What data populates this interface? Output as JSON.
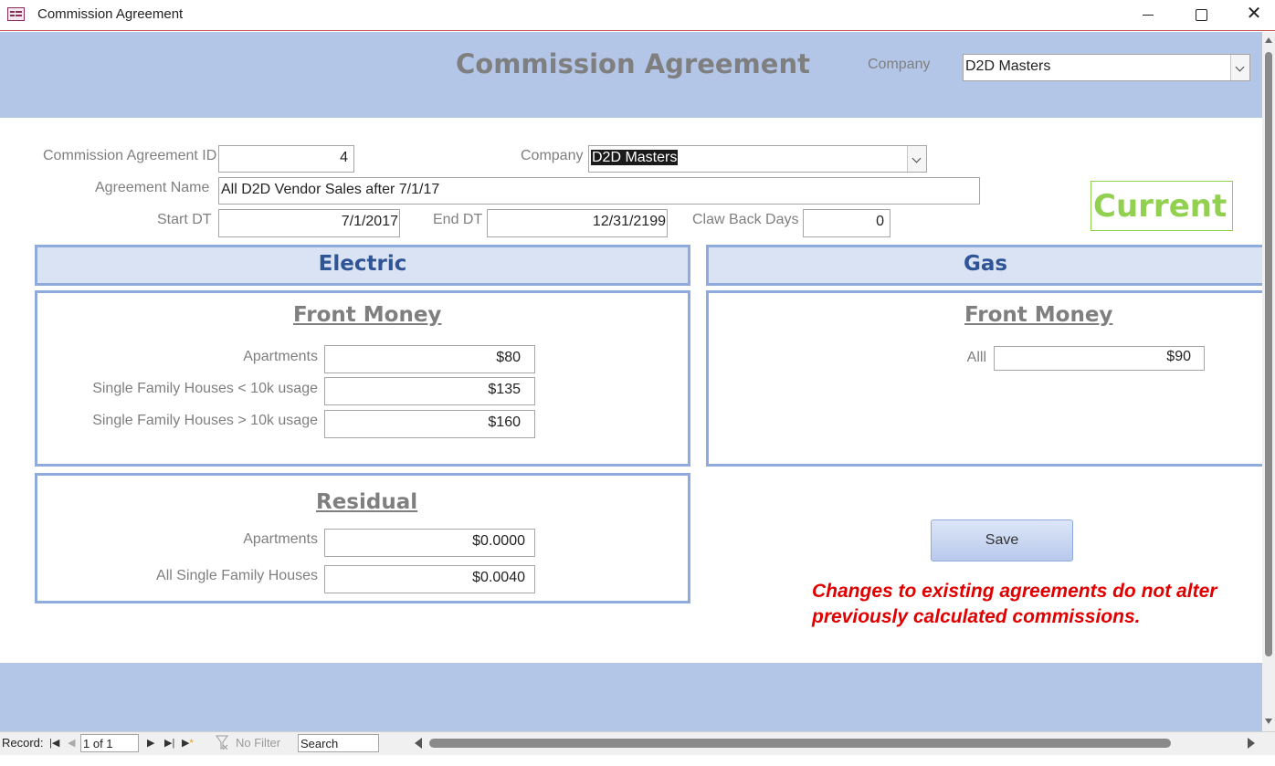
{
  "window": {
    "title": "Commission Agreement"
  },
  "header": {
    "title": "Commission Agreement",
    "company_label": "Company",
    "company_value": "D2D Masters"
  },
  "form": {
    "agreement_id_label": "Commission Agreement ID",
    "agreement_id_value": "4",
    "company_label": "Company",
    "company_value": "D2D Masters",
    "agreement_name_label": "Agreement Name",
    "agreement_name_value": "All D2D Vendor Sales after 7/1/17",
    "start_label": "Start DT",
    "start_value": "7/1/2017",
    "end_label": "End DT",
    "end_value": "12/31/2199",
    "clawback_label": "Claw Back Days",
    "clawback_value": "0",
    "status": "Current"
  },
  "electric": {
    "heading": "Electric",
    "front_money": {
      "title": "Front Money",
      "rows": [
        {
          "label": "Apartments",
          "value": "$80"
        },
        {
          "label": "Single Family Houses < 10k usage",
          "value": "$135"
        },
        {
          "label": "Single Family Houses > 10k usage",
          "value": "$160"
        }
      ]
    },
    "residual": {
      "title": "Residual",
      "rows": [
        {
          "label": "Apartments",
          "value": "$0.0000"
        },
        {
          "label": "All Single Family Houses",
          "value": "$0.0040"
        }
      ]
    }
  },
  "gas": {
    "heading": "Gas",
    "front_money": {
      "title": "Front Money",
      "rows": [
        {
          "label": "Alll",
          "value": "$90"
        }
      ]
    }
  },
  "actions": {
    "save_label": "Save",
    "warning": "Changes to existing agreements do not alter previously calculated commissions."
  },
  "navbar": {
    "record_label": "Record:",
    "record_position": "1 of 1",
    "filter_label": "No Filter",
    "search_value": "Search"
  },
  "colors": {
    "band": "#b4c6e7",
    "section_heading": "#2f5597",
    "status": "#92d050",
    "warning": "#e00000"
  }
}
